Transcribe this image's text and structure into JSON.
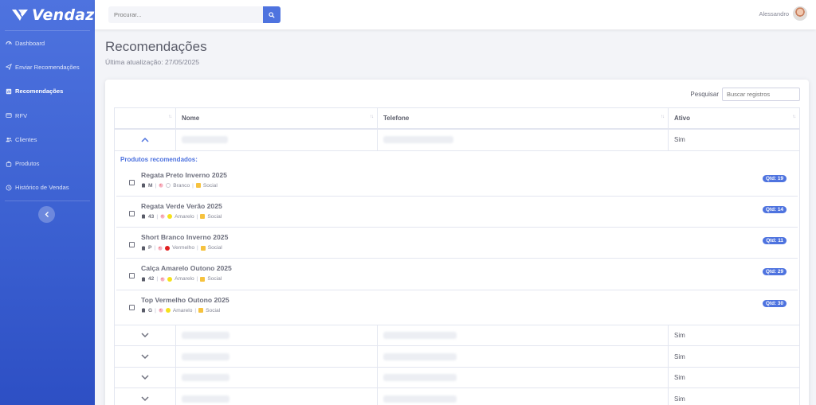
{
  "brand": {
    "name": "Vendaz"
  },
  "sidebar": {
    "items": [
      {
        "label": "Dashboard",
        "icon": "dashboard-icon",
        "active": false
      },
      {
        "label": "Enviar Recomendações",
        "icon": "send-icon",
        "active": false
      },
      {
        "label": "Recomendações",
        "icon": "recommendations-icon",
        "active": true
      },
      {
        "label": "RFV",
        "icon": "rfv-icon",
        "active": false
      },
      {
        "label": "Clientes",
        "icon": "users-icon",
        "active": false
      },
      {
        "label": "Produtos",
        "icon": "products-icon",
        "active": false
      },
      {
        "label": "Histórico de Vendas",
        "icon": "history-icon",
        "active": false
      }
    ],
    "toggle_icon": "chevron-left-icon"
  },
  "topbar": {
    "search_placeholder": "Procurar...",
    "search_icon": "search-icon",
    "user_name": "Alessandro"
  },
  "page": {
    "title": "Recomendações",
    "subtitle": "Última atualização: 27/05/2025"
  },
  "table": {
    "filter_label": "Pesquisar",
    "filter_placeholder": "Buscar registros",
    "columns": [
      "",
      "Nome",
      "Telefone",
      "Ativo"
    ],
    "expanded_row": {
      "ativo": "Sim"
    },
    "products_title": "Produtos recomendados:",
    "products": [
      {
        "name": "Regata Preto Inverno 2025",
        "size": "M",
        "color": "Branco",
        "color_hex": "#ffffff",
        "style": "Social",
        "qty": "Qtd: 19"
      },
      {
        "name": "Regata Verde Verão 2025",
        "size": "43",
        "color": "Amarelo",
        "color_hex": "#f5e11b",
        "style": "Social",
        "qty": "Qtd: 14"
      },
      {
        "name": "Short Branco Inverno 2025",
        "size": "P",
        "color": "Vermelho",
        "color_hex": "#e02020",
        "style": "Social",
        "qty": "Qtd: 11"
      },
      {
        "name": "Calça Amarelo Outono 2025",
        "size": "42",
        "color": "Amarelo",
        "color_hex": "#f5e11b",
        "style": "Social",
        "qty": "Qtd: 29"
      },
      {
        "name": "Top Vermelho Outono 2025",
        "size": "G",
        "color": "Amarelo",
        "color_hex": "#f5e11b",
        "style": "Social",
        "qty": "Qtd: 30"
      }
    ],
    "collapsed_rows": [
      {
        "ativo": "Sim"
      },
      {
        "ativo": "Sim"
      },
      {
        "ativo": "Sim"
      },
      {
        "ativo": "Sim"
      }
    ]
  },
  "colors": {
    "primary": "#4e73df",
    "text": "#5a5c69",
    "muted": "#858796"
  }
}
